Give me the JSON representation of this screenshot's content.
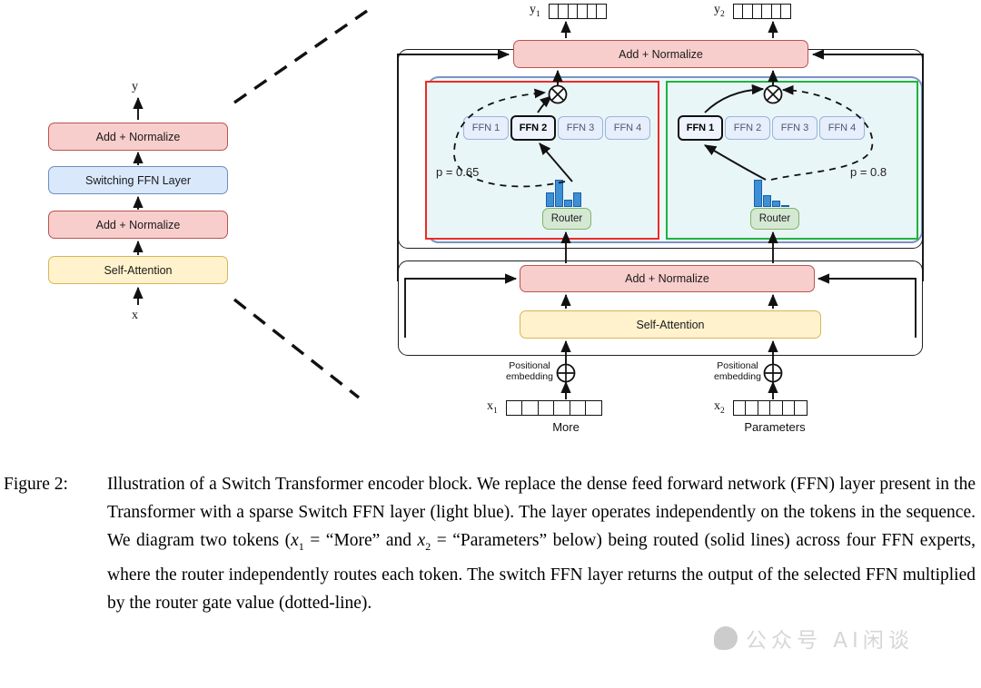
{
  "figure": {
    "label": "Figure 2:",
    "caption_parts": {
      "p1": "Illustration of a Switch Transformer encoder block. We replace the dense feed forward network (FFN) layer present in the Transformer with a sparse Switch FFN layer (light blue). The layer operates independently on the tokens in the sequence. We diagram two tokens (",
      "x1": "x",
      "x1sub": "1",
      "p2": " = “More” and ",
      "x2": "x",
      "x2sub": "2",
      "p3": " = “Parameters” below) being routed (solid lines) across four FFN experts, where the router independently routes each token. The switch FFN layer returns the output of the selected FFN multiplied by the router gate value (dotted-line)."
    }
  },
  "left_panel": {
    "output_label": "y",
    "input_label": "x",
    "blocks": [
      {
        "label": "Add + Normalize",
        "color": "pink"
      },
      {
        "label": "Switching FFN Layer",
        "color": "blue"
      },
      {
        "label": "Add + Normalize",
        "color": "pink"
      },
      {
        "label": "Self-Attention",
        "color": "yellow"
      }
    ]
  },
  "right_panel": {
    "outputs": [
      {
        "label": "y",
        "sub": "1",
        "cells": 6
      },
      {
        "label": "y",
        "sub": "2",
        "cells": 6
      }
    ],
    "inputs": [
      {
        "label": "x",
        "sub": "1",
        "cells": 6,
        "word": "More",
        "positional": "Positional\nembedding"
      },
      {
        "label": "x",
        "sub": "2",
        "cells": 6,
        "word": "Parameters",
        "positional": "Positional\nembedding"
      }
    ],
    "top_add_norm": "Add + Normalize",
    "bottom_add_norm": "Add + Normalize",
    "self_attention": "Self-Attention",
    "experts": [
      {
        "frame_color": "red",
        "gate_label": "p = 0.65",
        "router_label": "Router",
        "selected_index": 1,
        "ffns": [
          "FFN 1",
          "FFN 2",
          "FFN 3",
          "FFN 4"
        ],
        "router_probs": [
          0.55,
          1.0,
          0.28,
          0.52
        ]
      },
      {
        "frame_color": "green",
        "gate_label": "p = 0.8",
        "router_label": "Router",
        "selected_index": 0,
        "ffns": [
          "FFN 1",
          "FFN 2",
          "FFN 3",
          "FFN 4"
        ],
        "router_probs": [
          1.0,
          0.45,
          0.22,
          0.08
        ]
      }
    ],
    "multiply_icon": "circled-times"
  },
  "watermark": {
    "text": "公众号 AI闲谈"
  },
  "colors": {
    "pink_fill": "#f8cecc",
    "pink_border": "#b85450",
    "yellow_fill": "#fff2cc",
    "yellow_border": "#d6b656",
    "blue_fill": "#dae8fc",
    "blue_border": "#6c8ebf",
    "green_fill": "#d5e8d4",
    "green_border": "#82b366",
    "switch_fill": "#edf8f8",
    "switch_border": "#7b93c4",
    "expert_red": "#ef2a2a",
    "expert_green": "#1fb33f",
    "hist_bar": "#3d8fd6"
  }
}
